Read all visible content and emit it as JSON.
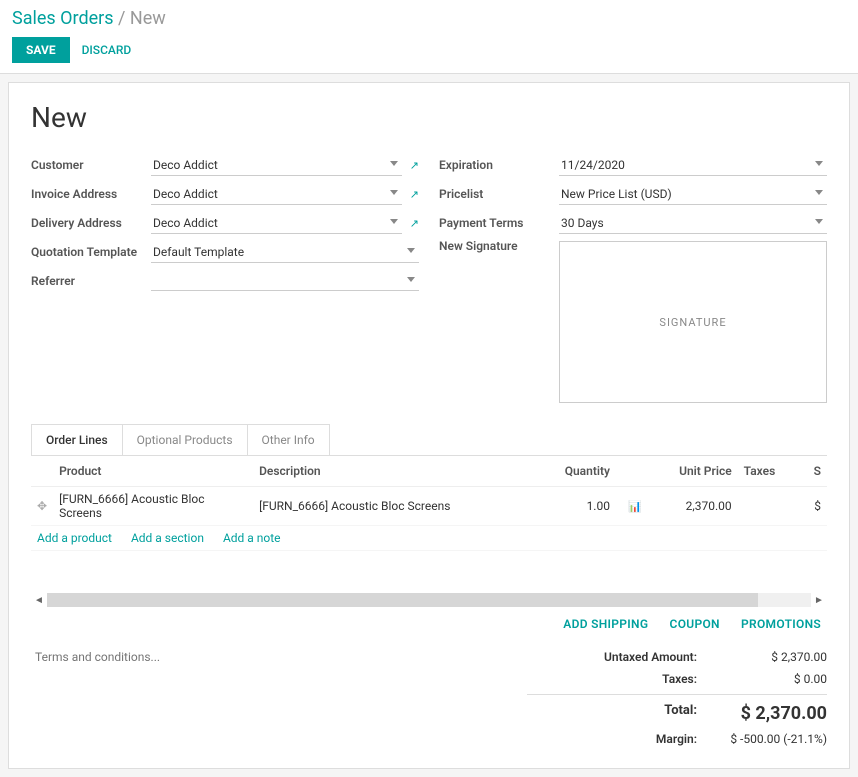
{
  "breadcrumb": {
    "root": "Sales Orders",
    "sep": " / ",
    "current": "New"
  },
  "toolbar": {
    "save": "SAVE",
    "discard": "DISCARD"
  },
  "title": "New",
  "left_fields": {
    "customer": {
      "label": "Customer",
      "value": "Deco Addict"
    },
    "invoice_address": {
      "label": "Invoice Address",
      "value": "Deco Addict"
    },
    "delivery_address": {
      "label": "Delivery Address",
      "value": "Deco Addict"
    },
    "quotation_template": {
      "label": "Quotation Template",
      "value": "Default Template"
    },
    "referrer": {
      "label": "Referrer",
      "value": ""
    }
  },
  "right_fields": {
    "expiration": {
      "label": "Expiration",
      "value": "11/24/2020"
    },
    "pricelist": {
      "label": "Pricelist",
      "value": "New Price List (USD)"
    },
    "payment_terms": {
      "label": "Payment Terms",
      "value": "30 Days"
    },
    "signature": {
      "label": "New Signature",
      "placeholder": "SIGNATURE"
    }
  },
  "tabs": {
    "order_lines": "Order Lines",
    "optional": "Optional Products",
    "other": "Other Info"
  },
  "columns": {
    "product": "Product",
    "description": "Description",
    "quantity": "Quantity",
    "unit_price": "Unit Price",
    "taxes": "Taxes",
    "subtotal": "S"
  },
  "rows": [
    {
      "product": "[FURN_6666] Acoustic Bloc Screens",
      "description": "[FURN_6666] Acoustic Bloc Screens",
      "qty": "1.00",
      "unit_price": "2,370.00",
      "taxes": "",
      "subtotal": "$"
    }
  ],
  "add": {
    "product": "Add a product",
    "section": "Add a section",
    "note": "Add a note"
  },
  "actions": {
    "shipping": "ADD SHIPPING",
    "coupon": "COUPON",
    "promotions": "PROMOTIONS"
  },
  "terms_placeholder": "Terms and conditions...",
  "totals": {
    "untaxed": {
      "label": "Untaxed Amount:",
      "value": "$ 2,370.00"
    },
    "taxes": {
      "label": "Taxes:",
      "value": "$ 0.00"
    },
    "total": {
      "label": "Total:",
      "value": "$ 2,370.00"
    },
    "margin": {
      "label": "Margin:",
      "value": "$ -500.00 (-21.1%)"
    }
  }
}
